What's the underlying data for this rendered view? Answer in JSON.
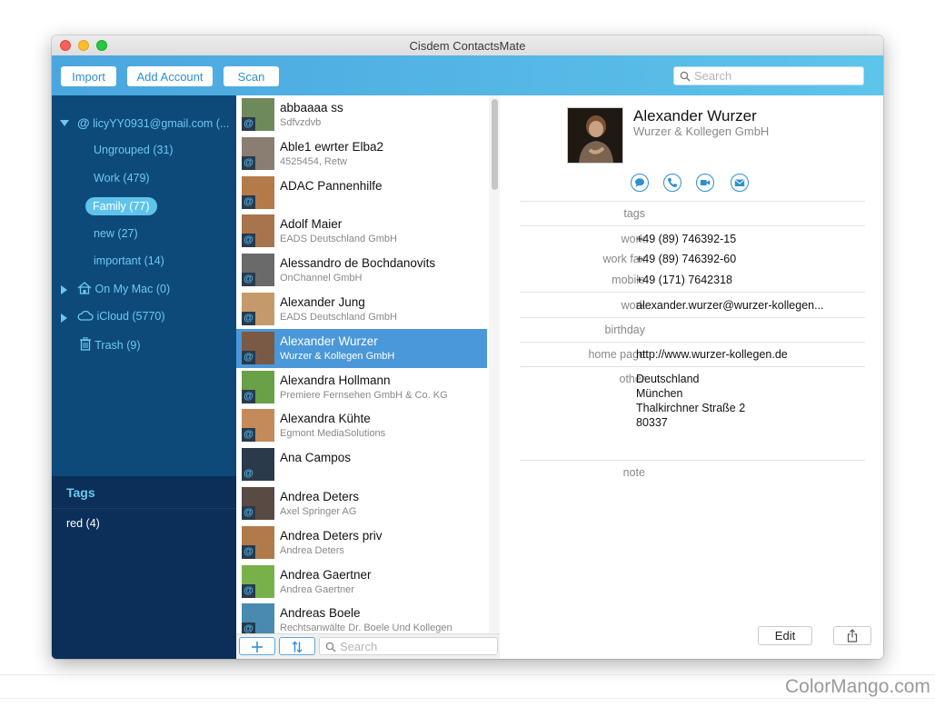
{
  "window": {
    "title": "Cisdem ContactsMate"
  },
  "toolbar": {
    "import_label": "Import",
    "add_account_label": "Add Account",
    "scan_label": "Scan",
    "search_placeholder": "Search"
  },
  "sidebar": {
    "account": "licyYY0931@gmail.com (...",
    "groups": [
      "Ungrouped (31)",
      "Work (479)",
      "Family (77)",
      "new (27)",
      "important (14)"
    ],
    "selected_group": "Family (77)",
    "on_my_mac": "On My Mac (0)",
    "icloud": "iCloud (5770)",
    "trash": "Trash (9)"
  },
  "tags": {
    "title": "Tags",
    "items": [
      "red (4)"
    ]
  },
  "contacts": [
    {
      "name": "abbaaaa ss",
      "sub": "Sdfvzdvb",
      "color": "#6f8a5a"
    },
    {
      "name": "Able1 ewrter Elba2",
      "sub": "4525454, Retw",
      "color": "#8a7d72"
    },
    {
      "name": "ADAC Pannenhilfe",
      "sub": "",
      "color": "#b57a4a"
    },
    {
      "name": "Adolf Maier",
      "sub": "EADS Deutschland GmbH",
      "color": "#a8744e"
    },
    {
      "name": "Alessandro de Bochdanovits",
      "sub": "OnChannel GmbH",
      "color": "#6a6a6a"
    },
    {
      "name": "Alexander Jung",
      "sub": "EADS Deutschland GmbH",
      "color": "#c49a6a"
    },
    {
      "name": "Alexander Wurzer",
      "sub": "Wurzer & Kollegen GmbH",
      "color": "#7a5a44"
    },
    {
      "name": "Alexandra Hollmann",
      "sub": "Premiere Fernsehen GmbH & Co. KG",
      "color": "#6aa048"
    },
    {
      "name": "Alexandra Kühte",
      "sub": "Egmont MediaSolutions",
      "color": "#c48a5a"
    },
    {
      "name": "Ana Campos",
      "sub": "",
      "color": "#2a3a4a"
    },
    {
      "name": "Andrea Deters",
      "sub": "Axel Springer AG",
      "color": "#5a4a44"
    },
    {
      "name": "Andrea Deters priv",
      "sub": "Andrea Deters",
      "color": "#b07a4a"
    },
    {
      "name": "Andrea Gaertner",
      "sub": "Andrea Gaertner",
      "color": "#78b04a"
    },
    {
      "name": "Andreas Boele",
      "sub": "Rechtsanwälte Dr. Boele Und Kollegen",
      "color": "#4a8ab0"
    }
  ],
  "selected_contact_index": 6,
  "list_footer": {
    "search_placeholder": "Search"
  },
  "detail": {
    "name": "Alexander Wurzer",
    "company": "Wurzer & Kollegen GmbH",
    "fields": {
      "tags_label": "tags",
      "work_label": "work",
      "work_value": "+49 (89) 746392-15",
      "work_fax_label": "work fax",
      "work_fax_value": "+49 (89) 746392-60",
      "mobile_label": "mobile",
      "mobile_value": "+49 (171) 7642318",
      "email_label": "work",
      "email_value": "alexander.wurzer@wurzer-kollegen...",
      "birthday_label": "birthday",
      "homepage_label": "home page",
      "homepage_value": "http://www.wurzer-kollegen.de",
      "address_label": "other",
      "address_lines": [
        "Deutschland",
        "München",
        "Thalkirchner Straße 2",
        "80337"
      ],
      "note_label": "note"
    },
    "edit_label": "Edit"
  },
  "watermark": "ColorMango.com",
  "colors": {
    "accent": "#2f8fd1",
    "sidebar": "#0d4a7a",
    "sidebar_text": "#6cc8f0",
    "selection": "#4a98d9"
  }
}
